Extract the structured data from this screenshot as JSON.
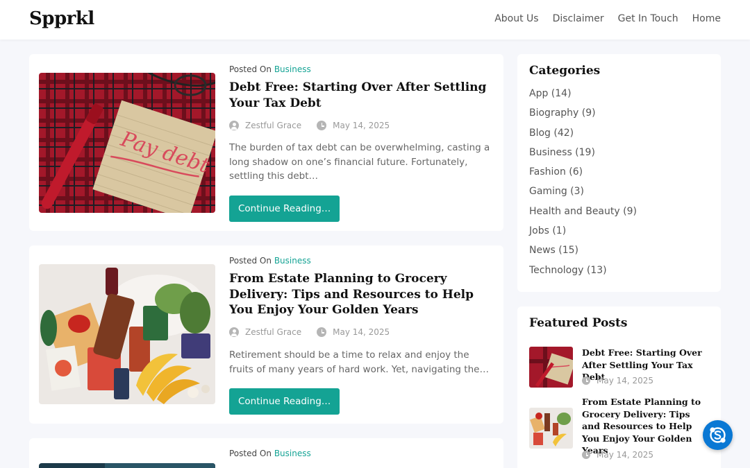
{
  "site": {
    "logo": "Spprkl"
  },
  "nav": [
    "About Us",
    "Disclaimer",
    "Get In Touch",
    "Home"
  ],
  "posts": [
    {
      "posted_on": "Posted On",
      "category": "Business",
      "title": "Debt Free: Starting Over After Settling Your Tax Debt",
      "author": "Zestful Grace",
      "date": "May 14, 2025",
      "excerpt": "The burden of tax debt can be overwhelming, casting a long shadow on one’s financial future. Fortunately, settling this debt…",
      "button": "Continue Reading…",
      "image_text": "Pay debt"
    },
    {
      "posted_on": "Posted On",
      "category": "Business",
      "title": "From Estate Planning to Grocery Delivery: Tips and Resources to Help You Enjoy Your Golden Years",
      "author": "Zestful Grace",
      "date": "May 14, 2025",
      "excerpt": "Retirement should be a time to relax and enjoy the fruits of many years of hard work. Yet, navigating the…",
      "button": "Continue Reading…"
    },
    {
      "posted_on": "Posted On",
      "category": "Business"
    }
  ],
  "sidebar": {
    "categories_title": "Categories",
    "categories": [
      "App (14)",
      "Biography (9)",
      "Blog (42)",
      "Business (19)",
      "Fashion (6)",
      "Gaming (3)",
      "Health and Beauty (9)",
      "Jobs (1)",
      "News (15)",
      "Technology (13)"
    ],
    "featured_title": "Featured Posts",
    "featured": [
      {
        "title": "Debt Free: Starting Over After Settling Your Tax Debt",
        "date": "May 14, 2025"
      },
      {
        "title": "From Estate Planning to Grocery Delivery: Tips and Resources to Help You Enjoy Your Golden Years",
        "date": "May 14, 2025"
      }
    ]
  },
  "colors": {
    "accent": "#14a394",
    "skype": "#0a78d4"
  },
  "icons": [
    "user-icon",
    "clock-icon",
    "skype-icon"
  ]
}
